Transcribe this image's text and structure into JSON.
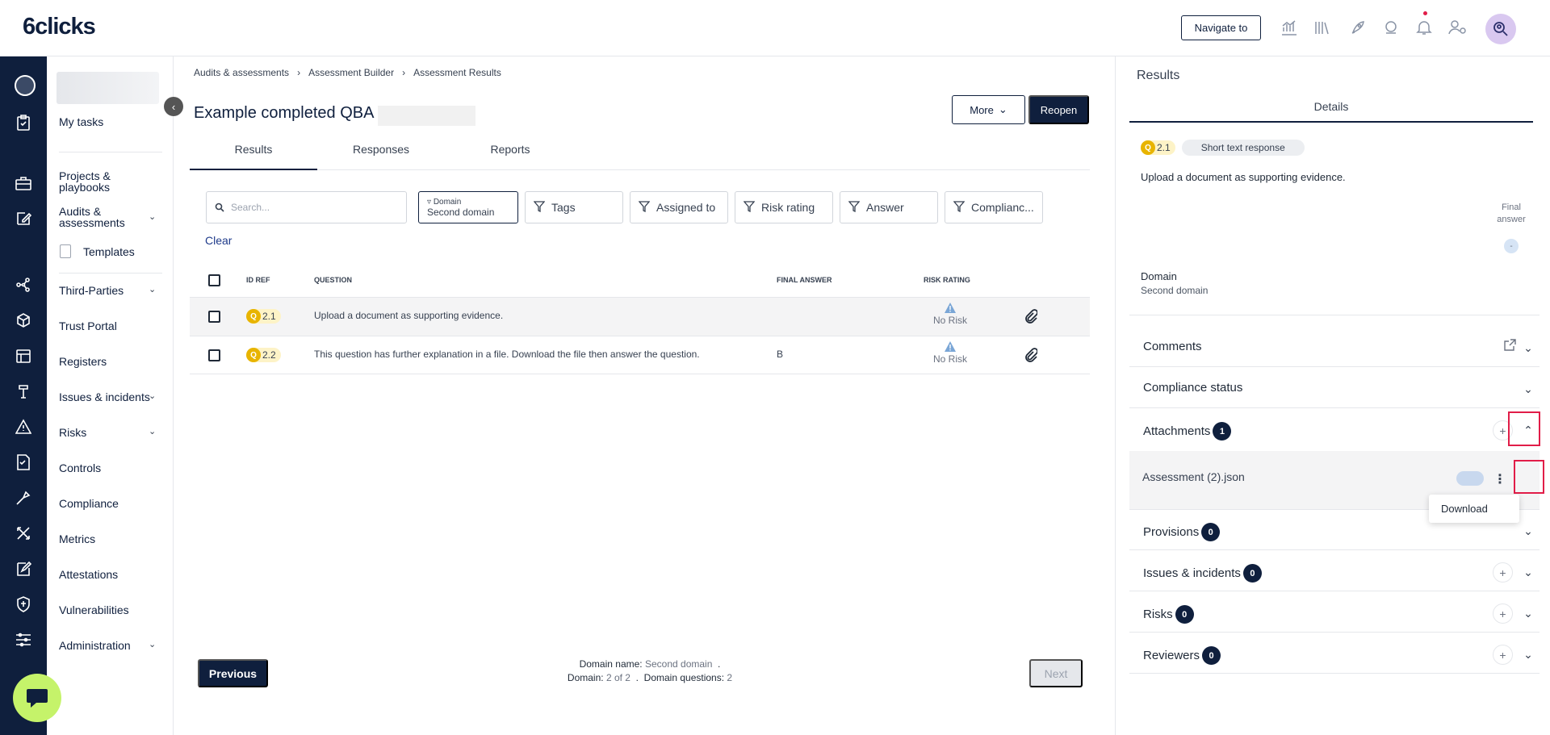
{
  "app": {
    "logo": "6clicks"
  },
  "topbar": {
    "navigate_label": "Navigate to",
    "icons": [
      "analytics-icon",
      "library-icon",
      "rocket-icon",
      "support-icon",
      "bell-icon",
      "users-settings-icon"
    ],
    "avatar_icon": "search-user-icon"
  },
  "rail": {
    "icons": [
      "org-icon",
      "clipboard-icon",
      "briefcase-icon",
      "edit-icon",
      "network-icon",
      "portal-icon",
      "registers-icon",
      "issues-icon",
      "warning-icon",
      "controls-icon",
      "compliance-icon",
      "metrics-icon",
      "attestations-icon",
      "shield-icon",
      "admin-sliders-icon"
    ]
  },
  "sidebar": {
    "items": [
      {
        "label": "My tasks"
      },
      {
        "label": "Projects &\nplaybooks"
      },
      {
        "label": "Audits &\nassessments"
      },
      {
        "label": "Templates"
      },
      {
        "label": "Third-Parties"
      },
      {
        "label": "Trust Portal"
      },
      {
        "label": "Registers"
      },
      {
        "label": "Issues & incidents"
      },
      {
        "label": "Risks"
      },
      {
        "label": "Controls"
      },
      {
        "label": "Compliance"
      },
      {
        "label": "Metrics"
      },
      {
        "label": "Attestations"
      },
      {
        "label": "Vulnerabilities"
      },
      {
        "label": "Administration"
      }
    ]
  },
  "breadcrumb": [
    "Audits & assessments",
    "Assessment Builder",
    "Assessment Results"
  ],
  "main": {
    "title": "Example completed QBA",
    "more_label": "More",
    "reopen_label": "Reopen",
    "tabs": [
      {
        "label": "Results"
      },
      {
        "label": "Responses"
      },
      {
        "label": "Reports"
      }
    ],
    "search_placeholder": "Search...",
    "filters": {
      "domain_label": "Domain",
      "domain_value": "Second domain",
      "tags": "Tags",
      "assigned": "Assigned to",
      "risk": "Risk rating",
      "answer": "Answer",
      "compliance": "Complianc..."
    },
    "clear_label": "Clear",
    "table": {
      "headers": {
        "id": "ID REF",
        "question": "QUESTION",
        "final": "FINAL ANSWER",
        "risk": "RISK RATING"
      },
      "rows": [
        {
          "badge": "Q",
          "id": "2.1",
          "question": "Upload a document as supporting evidence.",
          "answer": "",
          "risk": "No Risk"
        },
        {
          "badge": "Q",
          "id": "2.2",
          "question": "This question has further explanation in a file. Download the file then answer the question.",
          "answer": "B",
          "risk": "No Risk"
        }
      ]
    },
    "pagination": {
      "previous": "Previous",
      "next": "Next",
      "domain_name_label": "Domain name:",
      "domain_name_value": "Second domain",
      "domain_label": "Domain:",
      "domain_value": "2 of 2",
      "questions_label": "Domain questions:",
      "questions_value": "2"
    }
  },
  "panel": {
    "title": "Results",
    "tab": "Details",
    "badge": "Q",
    "id": "2.1",
    "type": "Short text response",
    "question": "Upload a document as supporting evidence.",
    "final_answer_label": "Final\nanswer",
    "final_answer_value": "-",
    "domain_label": "Domain",
    "domain_value": "Second domain",
    "sections": {
      "comments": "Comments",
      "compliance": "Compliance status",
      "attachments": "Attachments",
      "attachments_count": "1",
      "provisions": "Provisions",
      "provisions_count": "0",
      "issues": "Issues & incidents",
      "issues_count": "0",
      "risks": "Risks",
      "risks_count": "0",
      "reviewers": "Reviewers",
      "reviewers_count": "0"
    },
    "attachment_name": "Assessment (2).json",
    "dropdown_item": "Download"
  },
  "colors": {
    "navy": "#0f1f3d",
    "highlight": "#e11d48",
    "badge_yellow": "#e8b400",
    "chat": "#c5f36a"
  }
}
